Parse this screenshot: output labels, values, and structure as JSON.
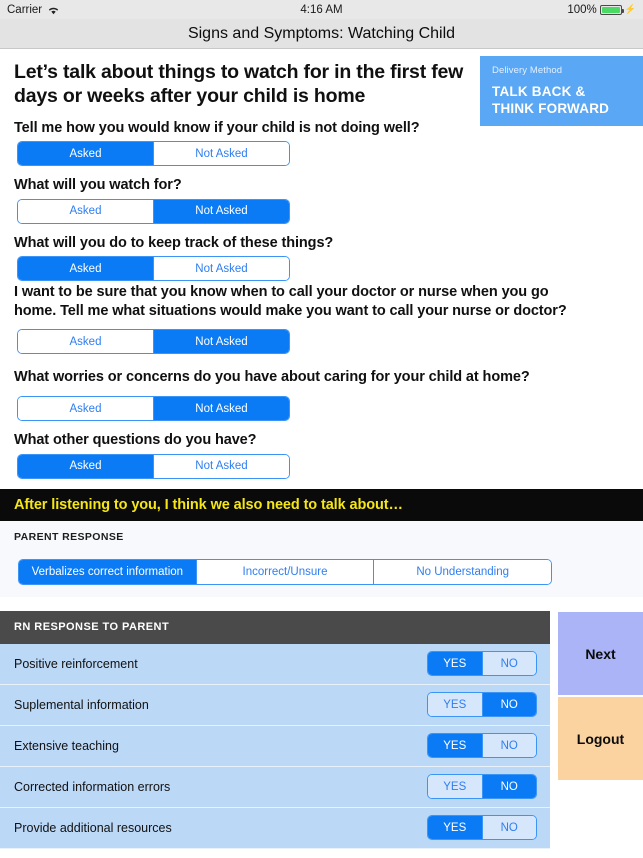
{
  "status_bar": {
    "carrier": "Carrier",
    "wifi_icon": "wifi-icon",
    "time": "4:16 AM",
    "battery_percent": "100%",
    "battery_icon": "battery-full-icon",
    "charging_icon": "lightning-bolt-icon"
  },
  "navbar": {
    "title": "Signs and Symptoms: Watching Child"
  },
  "headline": "Let’s talk about things to watch for in the first few days or weeks after your child is home",
  "delivery_method": {
    "label": "Delivery Method",
    "value": "TALK BACK &\nTHINK FORWARD",
    "value_line1": "TALK BACK &",
    "value_line2": "THINK FORWARD",
    "color": "#5aa7f5"
  },
  "ask_options": {
    "asked": "Asked",
    "not_asked": "Not Asked"
  },
  "questions": [
    {
      "text": "Tell me how you would know if your child is not doing  well?",
      "selected": "Asked"
    },
    {
      "text": "What will you watch for?",
      "selected": "Not Asked"
    },
    {
      "text": "What will you do to keep track of these things?",
      "selected": "Asked"
    },
    {
      "text": "I want to be sure that you know when to call your doctor or nurse when you go home. Tell me what situations would make you want to call your  nurse or doctor?",
      "selected": "Not Asked"
    },
    {
      "text": "What worries or concerns do you have about caring for your child at home?",
      "selected": "Not Asked"
    },
    {
      "text": "What other questions do you have?",
      "selected": "Asked"
    }
  ],
  "banner": {
    "text": "After listening to you, I think we also need to talk about…",
    "bg": "#0a0a0a",
    "fg": "#f5e618"
  },
  "parent_response": {
    "label": "PARENT RESPONSE",
    "options": [
      "Verbalizes correct  information",
      "Incorrect/Unsure",
      "No Understanding"
    ],
    "selected": "Verbalizes correct  information"
  },
  "rn_response": {
    "header": "RN RESPONSE TO PARENT",
    "yes_label": "YES",
    "no_label": "NO",
    "rows": [
      {
        "label": "Positive reinforcement",
        "selected": "YES"
      },
      {
        "label": "Suplemental information",
        "selected": "NO"
      },
      {
        "label": "Extensive teaching",
        "selected": "YES"
      },
      {
        "label": "Corrected information errors",
        "selected": "NO"
      },
      {
        "label": "Provide additional resources",
        "selected": "YES"
      }
    ]
  },
  "side_buttons": {
    "next": "Next",
    "logout": "Logout",
    "next_color": "#aab4f7",
    "logout_color": "#fbd3a0"
  },
  "accent_color": "#0b7bf5"
}
